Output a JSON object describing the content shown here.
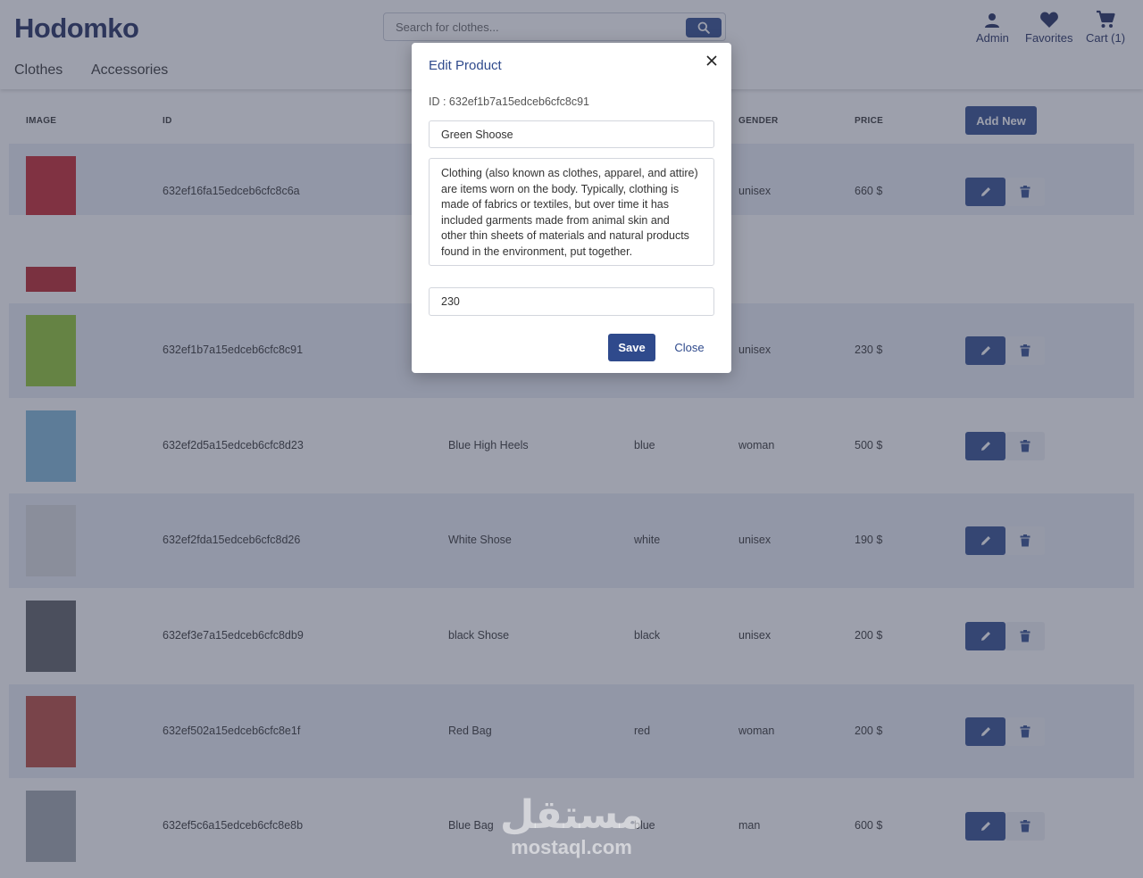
{
  "header": {
    "logo": "Hodomko",
    "search_placeholder": "Search for clothes...",
    "admin_label": "Admin",
    "favorites_label": "Favorites",
    "cart_label": "Cart (1)",
    "nav": [
      "Clothes",
      "Accessories"
    ]
  },
  "table": {
    "headers": {
      "image": "IMAGE",
      "id": "ID",
      "gender": "GENDER",
      "price": "PRICE"
    },
    "add_new_label": "Add New",
    "rows": [
      {
        "id": "632ef16fa15edceb6cfc8c6a",
        "name": "",
        "color": "",
        "gender": "unisex",
        "price": "660 $",
        "thumb_color": "#c4222b"
      },
      {
        "id": "",
        "name": "",
        "color": "",
        "gender": "",
        "price": "",
        "thumb_color": "#b82027"
      },
      {
        "id": "632ef1b7a15edceb6cfc8c91",
        "name": "",
        "color": "",
        "gender": "unisex",
        "price": "230 $",
        "thumb_color": "#8fc42e"
      },
      {
        "id": "632ef2d5a15edceb6cfc8d23",
        "name": "Blue High Heels",
        "color": "blue",
        "gender": "woman",
        "price": "500 $",
        "thumb_color": "#7fb6d6"
      },
      {
        "id": "632ef2fda15edceb6cfc8d26",
        "name": "White Shose",
        "color": "white",
        "gender": "unisex",
        "price": "190 $",
        "thumb_color": "#d8dadc"
      },
      {
        "id": "632ef3e7a15edceb6cfc8db9",
        "name": "black Shose",
        "color": "black",
        "gender": "unisex",
        "price": "200 $",
        "thumb_color": "#5a5c60"
      },
      {
        "id": "632ef502a15edceb6cfc8e1f",
        "name": "Red Bag",
        "color": "red",
        "gender": "woman",
        "price": "200 $",
        "thumb_color": "#b6463a"
      },
      {
        "id": "632ef5c6a15edceb6cfc8e8b",
        "name": "Blue Bag",
        "color": "blue",
        "gender": "man",
        "price": "600 $",
        "thumb_color": "#9fa5ab"
      }
    ]
  },
  "modal": {
    "title": "Edit Product",
    "id_text": "ID : 632ef1b7a15edceb6cfc8c91",
    "name_value": "Green Shoose",
    "description_lines": [
      "Clothing (also known as clothes, apparel, and attire)",
      "are items worn on the body. Typically, clothing is",
      "made of fabrics or textiles, but over time it has",
      "included garments made from animal skin and",
      "other thin sheets of materials and natural products",
      "found in the environment, put together."
    ],
    "price_value": "230",
    "save_label": "Save",
    "close_label": "Close"
  },
  "watermark": {
    "arabic": "مستقل",
    "latin": "mostaql.com"
  },
  "colors": {
    "primary": "#2f4a8c",
    "brand": "#1f2a5c",
    "row_alt": "#e9ecf4"
  }
}
